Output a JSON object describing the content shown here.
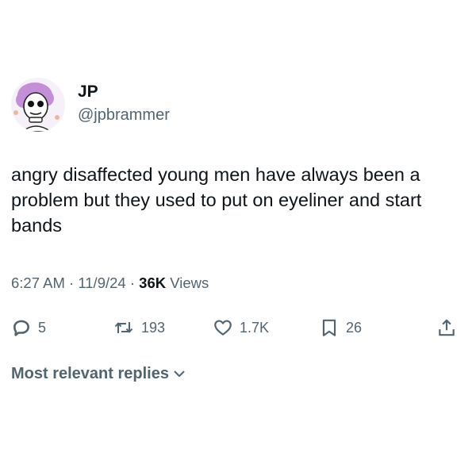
{
  "tweet": {
    "author": {
      "name": "JP",
      "handle": "@jpbrammer"
    },
    "text": "angry disaffected young men have always been a problem but they used to put on eyeliner and start bands",
    "time": "6:27 AM",
    "separator1": " · ",
    "date": "11/9/24",
    "separator2": " · ",
    "views_count": "36K",
    "views_label": " Views",
    "actions": {
      "replies": "5",
      "reposts": "193",
      "likes": "1.7K",
      "bookmarks": "26"
    },
    "replies_filter": "Most relevant replies"
  },
  "colors": {
    "text_primary": "#0f1419",
    "text_secondary": "#536471",
    "avatar_hair": "#c48fd6"
  },
  "icons": {
    "reply": "speech-bubble-icon",
    "repost": "repost-arrows-icon",
    "like": "heart-icon",
    "bookmark": "bookmark-icon",
    "share": "share-arrow-icon",
    "chevron": "chevron-down-icon"
  }
}
